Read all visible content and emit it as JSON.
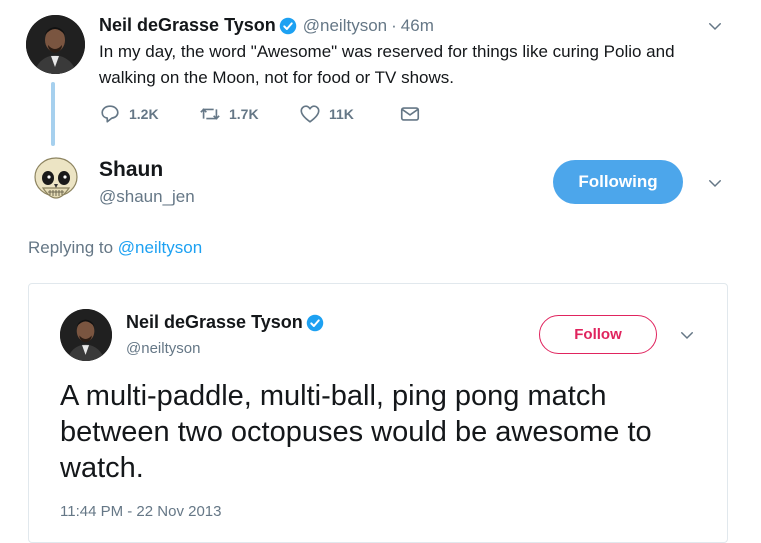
{
  "tweet": {
    "author_name": "Neil deGrasse Tyson",
    "author_handle": "@neiltyson",
    "separator": "·",
    "time": "46m",
    "text": "In my day, the word \"Awesome\" was reserved for things like curing Polio and walking on the Moon, not for food or TV shows.",
    "replies": "1.2K",
    "retweets": "1.7K",
    "likes": "11K",
    "icons": [
      "reply-icon",
      "retweet-icon",
      "like-icon",
      "message-icon",
      "chevron-down-icon",
      "verified-badge-icon"
    ]
  },
  "reply": {
    "author_name": "Shaun",
    "author_handle": "@shaun_jen",
    "following_label": "Following",
    "replying_prefix": "Replying to",
    "replying_to": "@neiltyson"
  },
  "quoted": {
    "author_name": "Neil deGrasse Tyson",
    "author_handle": "@neiltyson",
    "follow_label": "Follow",
    "text": "A multi-paddle, multi-ball, ping pong match between two octopuses would be awesome to watch.",
    "timestamp": "11:44 PM - 22 Nov 2013"
  },
  "colors": {
    "twitter_blue": "#1da1f2",
    "following_button": "#4ca6eb",
    "follow_border": "#e0245e",
    "muted": "#657786",
    "thread_line": "#a6d0ee"
  }
}
